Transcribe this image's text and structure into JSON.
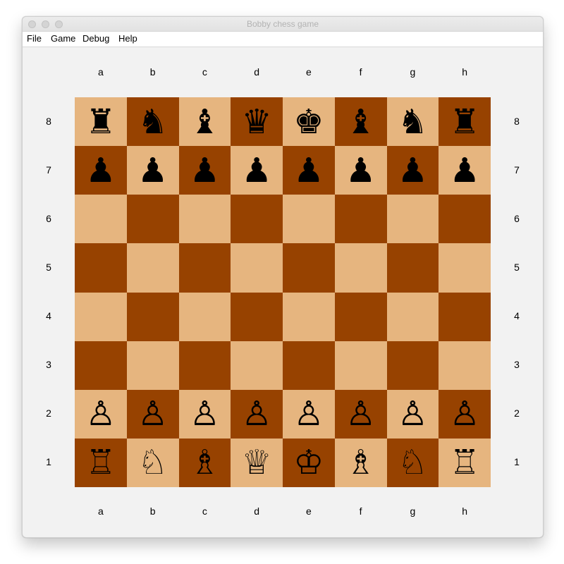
{
  "window": {
    "title": "Bobby chess game"
  },
  "menu": {
    "items": [
      "File",
      "Game",
      "Debug",
      "Help"
    ]
  },
  "board": {
    "files": [
      "a",
      "b",
      "c",
      "d",
      "e",
      "f",
      "g",
      "h"
    ],
    "ranks": [
      "8",
      "7",
      "6",
      "5",
      "4",
      "3",
      "2",
      "1"
    ],
    "light_color": "#e6b57f",
    "dark_color": "#974200",
    "pieces": {
      "a8": "♜",
      "b8": "♞",
      "c8": "♝",
      "d8": "♛",
      "e8": "♚",
      "f8": "♝",
      "g8": "♞",
      "h8": "♜",
      "a7": "♟",
      "b7": "♟",
      "c7": "♟",
      "d7": "♟",
      "e7": "♟",
      "f7": "♟",
      "g7": "♟",
      "h7": "♟",
      "a2": "♙",
      "b2": "♙",
      "c2": "♙",
      "d2": "♙",
      "e2": "♙",
      "f2": "♙",
      "g2": "♙",
      "h2": "♙",
      "a1": "♖",
      "b1": "♘",
      "c1": "♗",
      "d1": "♕",
      "e1": "♔",
      "f1": "♗",
      "g1": "♘",
      "h1": "♖"
    }
  }
}
